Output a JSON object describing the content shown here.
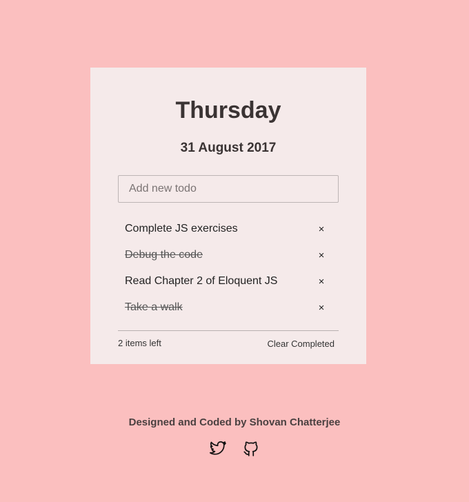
{
  "header": {
    "day": "Thursday",
    "date": "31 August 2017"
  },
  "input": {
    "placeholder": "Add new todo",
    "value": ""
  },
  "todos": [
    {
      "text": "Complete JS exercises",
      "completed": false,
      "delete_label": "×"
    },
    {
      "text": "Debug the code",
      "completed": true,
      "delete_label": "×"
    },
    {
      "text": "Read Chapter 2 of Eloquent JS",
      "completed": false,
      "delete_label": "×"
    },
    {
      "text": "Take a walk",
      "completed": true,
      "delete_label": "×"
    }
  ],
  "footer": {
    "items_left": "2 items left",
    "clear_completed": "Clear Completed"
  },
  "credit": "Designed and Coded by Shovan Chatterjee",
  "social": {
    "icons": [
      "twitter-icon",
      "github-icon"
    ]
  },
  "colors": {
    "background": "#fbbfbf",
    "card": "#f5eaea",
    "text": "#3a3333"
  }
}
